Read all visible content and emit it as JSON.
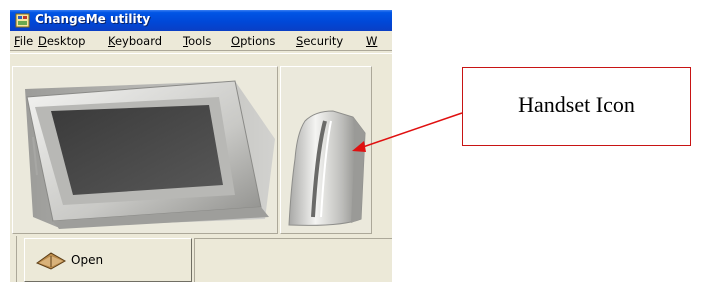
{
  "window": {
    "title": "ChangeMe utility",
    "title_icon": "app-icon"
  },
  "menu": [
    {
      "label": "File",
      "accel": "F",
      "rest": "ile"
    },
    {
      "label": "Desktop",
      "accel": "D",
      "rest": "esktop"
    },
    {
      "label": "Keyboard",
      "accel": "K",
      "rest": "eyboard"
    },
    {
      "label": "Tools",
      "accel": "T",
      "rest": "ools"
    },
    {
      "label": "Options",
      "accel": "O",
      "rest": "ptions"
    },
    {
      "label": "Security",
      "accel": "S",
      "rest": "ecurity"
    },
    {
      "label": "W",
      "accel": "W",
      "rest": ""
    }
  ],
  "toolbar": {
    "items": [
      {
        "name": "monitor",
        "icon": "monitor-icon"
      },
      {
        "name": "handset",
        "icon": "handset-icon"
      }
    ]
  },
  "bottom": {
    "open_label": "Open",
    "open_icon": "open-book-icon"
  },
  "callout": {
    "text": "Handset Icon",
    "color": "#c81414"
  },
  "colors": {
    "titlebar": "#0048d8",
    "face": "#ece9d8"
  }
}
